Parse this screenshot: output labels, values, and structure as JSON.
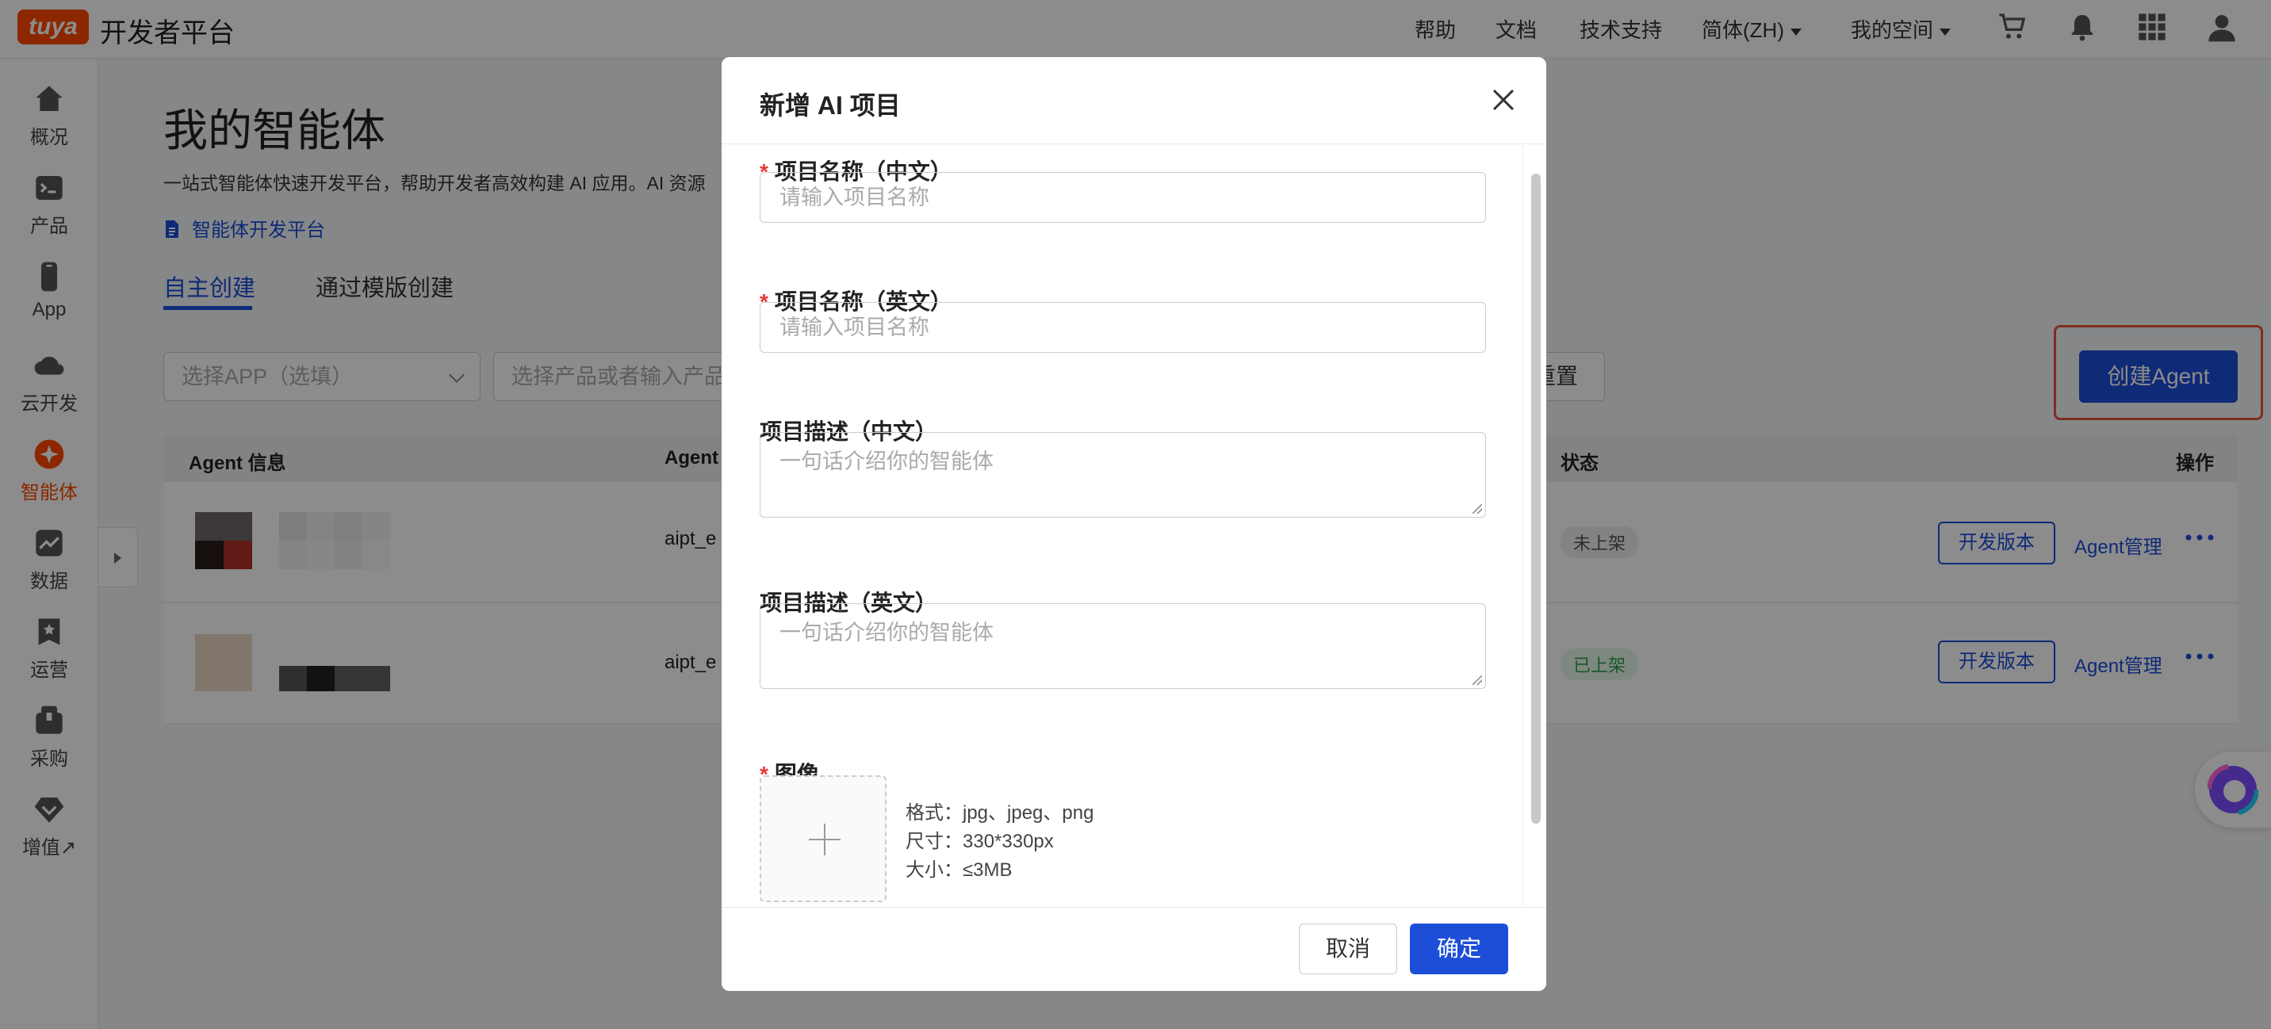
{
  "header": {
    "logo": "tuya",
    "brand": "开发者平台",
    "nav": [
      "帮助",
      "文档",
      "技术支持",
      "简体(ZH)",
      "我的空间"
    ],
    "icons": [
      "cart-icon",
      "bell-icon",
      "apps-grid-icon",
      "user-icon"
    ]
  },
  "sidebar": {
    "items": [
      {
        "label": "概况",
        "icon": "home-icon"
      },
      {
        "label": "产品",
        "icon": "terminal-icon"
      },
      {
        "label": "App",
        "icon": "phone-icon"
      },
      {
        "label": "云开发",
        "icon": "cloud-icon"
      },
      {
        "label": "智能体",
        "icon": "sparkle-icon"
      },
      {
        "label": "数据",
        "icon": "chart-icon"
      },
      {
        "label": "运营",
        "icon": "star-bookmark-icon"
      },
      {
        "label": "采购",
        "icon": "box-icon"
      },
      {
        "label": "增值↗",
        "icon": "diamond-icon"
      }
    ],
    "active_index": 4
  },
  "main": {
    "title": "我的智能体",
    "description": "一站式智能体快速开发平台，帮助开发者高效构建 AI 应用。AI 资源",
    "platform_link": "智能体开发平台",
    "tabs": [
      "自主创建",
      "通过模版创建"
    ],
    "filters": {
      "app_select": "选择APP（选填）",
      "product_select": "选择产品或者输入产品",
      "reset": "重置"
    },
    "create_button": "创建Agent",
    "table": {
      "headers": [
        "Agent 信息",
        "Agent",
        "状态",
        "操作"
      ],
      "rows": [
        {
          "agent_id": "aipt_e",
          "status": "未上架",
          "dev_button": "开发版本",
          "manage": "Agent管理"
        },
        {
          "agent_id": "aipt_e",
          "status": "已上架",
          "dev_button": "开发版本",
          "manage": "Agent管理"
        }
      ]
    }
  },
  "modal": {
    "title": "新增 AI 项目",
    "fields": {
      "name_cn": {
        "label": "项目名称（中文）",
        "placeholder": "请输入项目名称"
      },
      "name_en": {
        "label": "项目名称（英文）",
        "placeholder": "请输入项目名称"
      },
      "desc_cn": {
        "label": "项目描述（中文）",
        "placeholder": "一句话介绍你的智能体"
      },
      "desc_en": {
        "label": "项目描述（英文）",
        "placeholder": "一句话介绍你的智能体"
      },
      "image": {
        "label": "图像",
        "format": "格式：jpg、jpeg、png",
        "size": "尺寸：330*330px",
        "filesize": "大小：≤3MB"
      }
    },
    "cancel": "取消",
    "confirm": "确定"
  },
  "colors": {
    "primary": "#1d4ed8",
    "brand": "#ff4800",
    "required": "#e83a3a",
    "highlight": "#e8553a"
  }
}
